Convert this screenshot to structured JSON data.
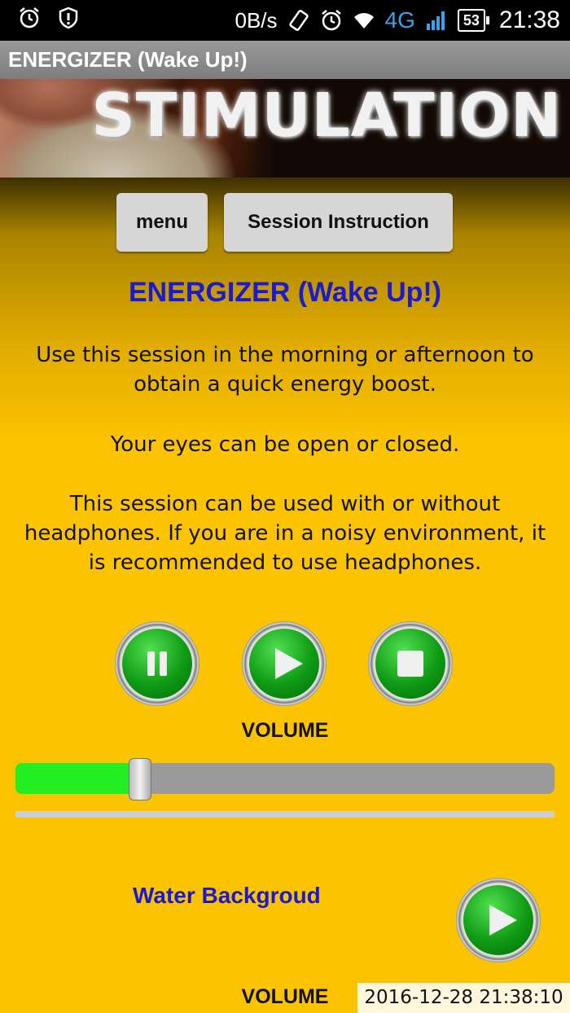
{
  "status_bar": {
    "left_icons": [
      "alarm-icon",
      "alert-icon"
    ],
    "net_speed": "0B/s",
    "network": "4G",
    "battery": "53",
    "clock": "21:38"
  },
  "app": {
    "title": "ENERGIZER (Wake Up!)"
  },
  "banner": {
    "title": "STIMULATION"
  },
  "buttons": {
    "menu": "menu",
    "session_instruction": "Session Instruction"
  },
  "session": {
    "title": "ENERGIZER (Wake Up!)",
    "paragraphs": [
      "Use this session in the morning or afternoon to obtain a quick energy boost.",
      "Your eyes can be open or closed.",
      "This session can be used with or without headphones. If you are in a noisy environment, it is recommended to use headphones."
    ]
  },
  "controls": {
    "icons": [
      "pause-icon",
      "play-icon",
      "stop-icon"
    ]
  },
  "volume": {
    "label": "VOLUME",
    "level_percent": 22
  },
  "background_track": {
    "label": "Water Backgroud",
    "volume_label": "VOLUME"
  },
  "timestamp": "2016-12-28 21:38:10",
  "colors": {
    "accent_text": "#1a1ad0",
    "background": "#fcc400",
    "button_green": "#0f9a15",
    "slider_fill": "#22ee22"
  }
}
